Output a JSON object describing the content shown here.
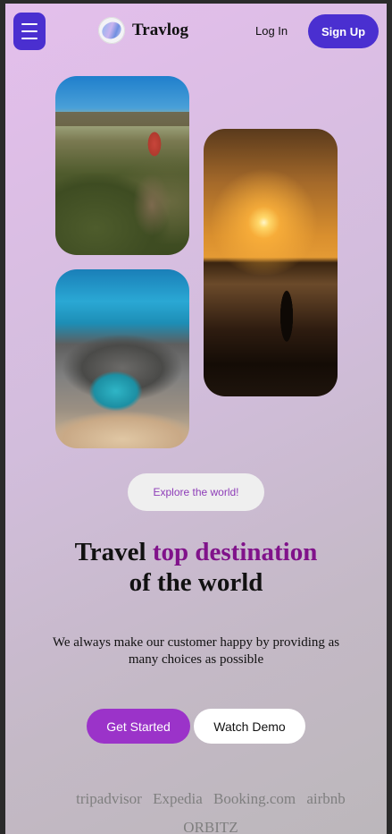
{
  "header": {
    "brand": "Travlog",
    "login_label": "Log In",
    "signup_label": "Sign Up"
  },
  "hero": {
    "explore_label": "Explore the world!",
    "heading_part1": "Travel ",
    "heading_highlight": "top destination",
    "heading_part2": "of the world",
    "description": "We always make our customer happy by providing as many choices as possible",
    "get_started_label": "Get Started",
    "watch_demo_label": "Watch Demo"
  },
  "partners": [
    "tripadvisor",
    "Expedia",
    "Booking.com",
    "airbnb",
    "ORBITZ"
  ],
  "colors": {
    "primary": "#4a2fd0",
    "accent": "#9b33c9",
    "highlight": "#80128a"
  },
  "icons": {
    "menu": "hamburger-menu-icon",
    "logo": "travlog-logo-icon"
  }
}
